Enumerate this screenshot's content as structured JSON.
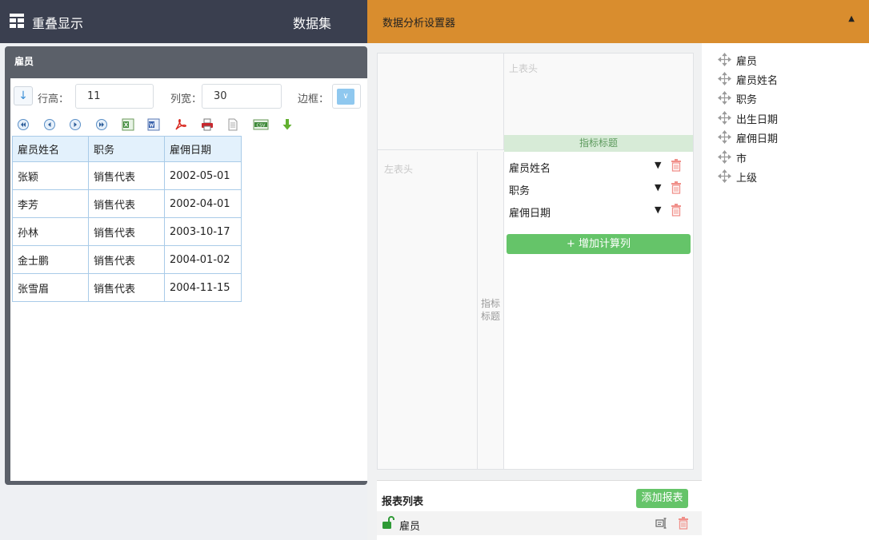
{
  "header": {
    "title": "重叠显示",
    "dataset_label": "数据集",
    "designer_title": "数据分析设置器"
  },
  "report_panel": {
    "title": "雇员",
    "row_height_label": "行高：",
    "row_height_value": "11",
    "col_width_label": "列宽：",
    "col_width_value": "30",
    "border_label": "边框：",
    "border_color": "#8fc8ef"
  },
  "toolbar_icons": [
    "first-page-icon",
    "prev-page-icon",
    "next-page-icon",
    "last-page-icon",
    "excel-icon",
    "word-icon",
    "pdf-icon",
    "print-icon",
    "text-icon",
    "csv-icon",
    "download-icon"
  ],
  "table": {
    "headers": [
      "雇员姓名",
      "职务",
      "雇佣日期"
    ],
    "rows": [
      [
        "张颖",
        "销售代表",
        "2002-05-01"
      ],
      [
        "李芳",
        "销售代表",
        "2002-04-01"
      ],
      [
        "孙林",
        "销售代表",
        "2003-10-17"
      ],
      [
        "金士鹏",
        "销售代表",
        "2004-01-02"
      ],
      [
        "张雪眉",
        "销售代表",
        "2004-11-15"
      ]
    ]
  },
  "designer": {
    "top_header_placeholder": "上表头",
    "left_header_placeholder": "左表头",
    "metric_title": "指标标题",
    "vertical_metric_title_1": "指标",
    "vertical_metric_title_2": "标题",
    "fields": [
      "雇员姓名",
      "职务",
      "雇佣日期"
    ],
    "add_calc_label": "+ 增加计算列"
  },
  "report_list": {
    "title": "报表列表",
    "add_label": "添加报表",
    "items": [
      "雇员"
    ]
  },
  "field_tree": [
    "雇员",
    "雇员姓名",
    "职务",
    "出生日期",
    "雇佣日期",
    "市",
    "上级"
  ],
  "colors": {
    "topbar": "#3a3f4f",
    "designer_header": "#d98d2e",
    "green_button": "#65c469",
    "table_border": "#a9cbe8"
  }
}
